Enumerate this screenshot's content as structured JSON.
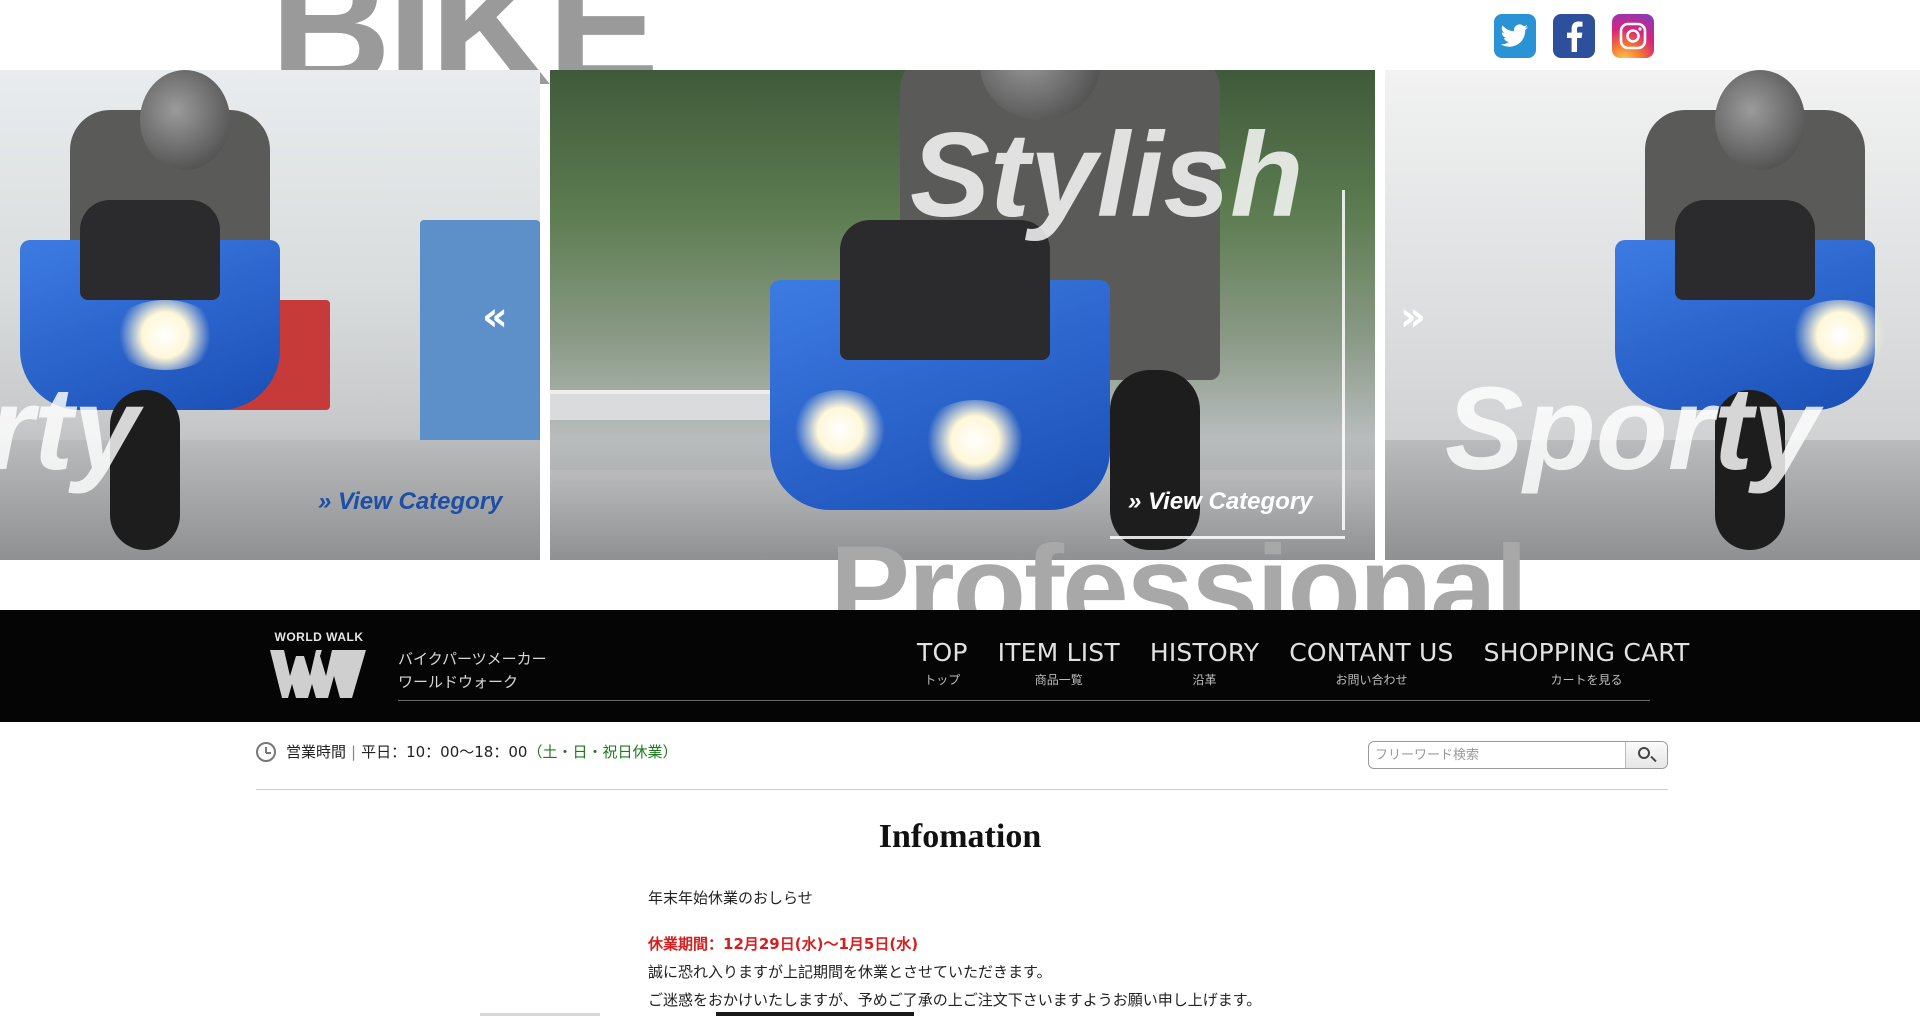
{
  "background_words": {
    "top": "BIKE",
    "bottom": "Professional"
  },
  "social": [
    {
      "name": "Twitter",
      "icon": "twitter-icon",
      "color": "#2a93d6"
    },
    {
      "name": "Facebook",
      "icon": "facebook-icon",
      "color": "#2d4f9c"
    },
    {
      "name": "Instagram",
      "icon": "instagram-icon",
      "color": "#d6247c"
    }
  ],
  "slider": {
    "left": {
      "word": "rty",
      "link": "» View Category"
    },
    "center": {
      "word": "Stylish",
      "link": "» View Category"
    },
    "right": {
      "word": "Sporty"
    },
    "prev_arrow": "«",
    "next_arrow": "»"
  },
  "header": {
    "logo_text": "WORLD WALK",
    "tagline_line1": "バイクパーツメーカー",
    "tagline_line2": "ワールドウォーク",
    "nav": [
      {
        "en": "TOP",
        "jp": "トップ"
      },
      {
        "en": "ITEM LIST",
        "jp": "商品一覧"
      },
      {
        "en": "HISTORY",
        "jp": "沿革"
      },
      {
        "en": "CONTANT US",
        "jp": "お問い合わせ"
      },
      {
        "en": "SHOPPING CART",
        "jp": "カートを見る"
      }
    ]
  },
  "hours": {
    "label": "営業時間",
    "time": "平日：10：00〜18：00",
    "holiday": "（土・日・祝日休業）"
  },
  "search": {
    "placeholder": "フリーワード検索"
  },
  "info": {
    "title": "Infomation",
    "heading": "年末年始休業のおしらせ",
    "period": "休業期間：12月29日(水)〜1月5日(水)",
    "line1": "誠に恐れ入りますが上記期間を休業とさせていただきます。",
    "line2": "ご迷惑をおかけいたしますが、予めご了承の上ご注文下さいますようお願い申し上げます。"
  },
  "colors": {
    "accent_blue": "#1d4fa8",
    "holiday_green": "#1d7a1d",
    "notice_red": "#d61e1e",
    "nav_bg": "#050505"
  }
}
